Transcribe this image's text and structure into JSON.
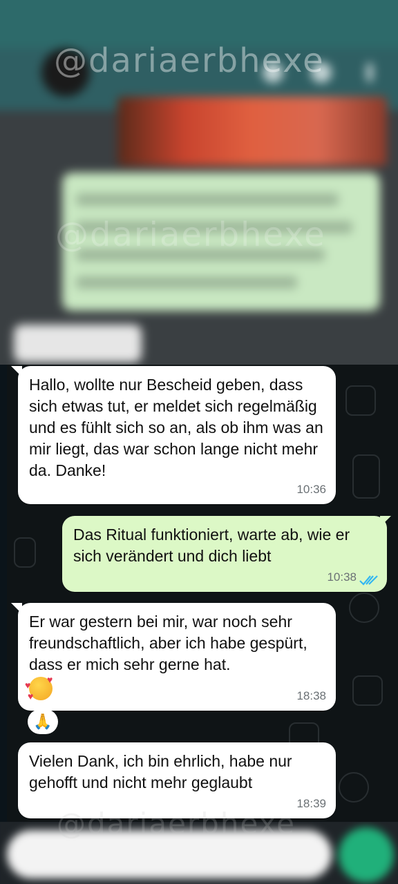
{
  "watermark": "@dariaerbhexe",
  "messages": [
    {
      "text": "Hallo, wollte nur Bescheid geben, dass sich etwas tut, er meldet sich regelmäßig und es fühlt sich so an, als ob ihm was an mir liegt, das war schon lange nicht mehr da. Danke!",
      "time": "10:36"
    },
    {
      "text": "Das Ritual funktioniert, warte ab, wie er sich verändert und dich liebt",
      "time": "10:38"
    },
    {
      "text": "Er war gestern bei mir, war noch sehr freundschaftlich, aber ich habe gespürt, dass er mich sehr gerne hat.",
      "time": "18:38"
    },
    {
      "text": "Vielen Dank, ich bin ehrlich, habe nur gehofft und nicht mehr geglaubt",
      "time": "18:39"
    }
  ],
  "reaction": "🙏",
  "colors": {
    "incoming": "#ffffff",
    "outgoing": "#dcf8c6",
    "read_ticks": "#34b7f1",
    "mic": "#20b07a"
  },
  "icons": [
    "double-check-icon",
    "smiling-face-hearts-icon",
    "folded-hands-icon",
    "mic-icon"
  ]
}
